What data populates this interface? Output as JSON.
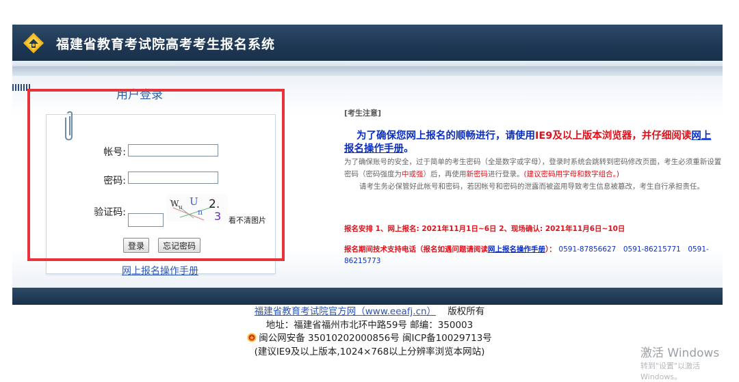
{
  "header": {
    "title": "福建省教育考试院高考考生报名系统"
  },
  "login": {
    "title": "用户登录",
    "account_label": "帐号:",
    "password_label": "密码:",
    "captcha_label": "验证码:",
    "captcha_text": "WUn23",
    "refresh_label": "看不清图片",
    "login_button": "登录",
    "forgot_button": "忘记密码",
    "manual_link": "网上报名操作手册"
  },
  "notice": {
    "heading": "[考生注意]",
    "lead_part1": "为了确保您网上报名的顺畅进行，请使用",
    "lead_red": "IE9及以上版本浏览器",
    "lead_part2": "，并仔细阅读",
    "lead_link": "网上报名操作手册",
    "lead_end": "。",
    "p1_a": "为了确保账号的安全，过于简单的考生密码（全是数字或字母），登录时系统会跳转到密码修改页面，考生必须重新设置密码（密码强度为",
    "p1_red1": "中或强",
    "p1_b": "）后，再使用",
    "p1_red2": "新密码",
    "p1_c": "进行登录。",
    "p1_red3": "(建议密码用字母和数字组合。)",
    "p2": "请考生务必保管好此帐号和密码，若因帐号和密码的泄露而被盗用导致考生信息被篡改，考生自行承担责任。",
    "schedule": "报名安排 1、网上报名: 2021年11月1日~6日 2、现场确认: 2021年11月6日~10日",
    "support_label": "报名期间技术支持电话（报名如遇问题请阅读",
    "support_link": "网上报名操作手册",
    "support_end": "）：",
    "support_phones": "0591-87856627　0591-86215771　0591-86215773"
  },
  "footer": {
    "site_link": "福建省教育考试院官方网（www.eeafj.cn）",
    "copyright": "版权所有",
    "address": "地址：福建省福州市北环中路59号 邮编：350003",
    "police": "闽公网安备 35010202000856号 闽ICP备10029713号",
    "browser_hint": "(建议IE9及以上版本,1024×768以上分辨率浏览本网站)"
  },
  "watermark": {
    "line1": "激活 Windows",
    "line2": "转到\"设置\"以激活 Windows。"
  },
  "colors": {
    "header_bg": "#1f3855",
    "link_blue": "#2d56b4",
    "notice_blue": "#0b2fc2",
    "notice_red": "#e0101a",
    "highlight_red": "#e8323c"
  }
}
